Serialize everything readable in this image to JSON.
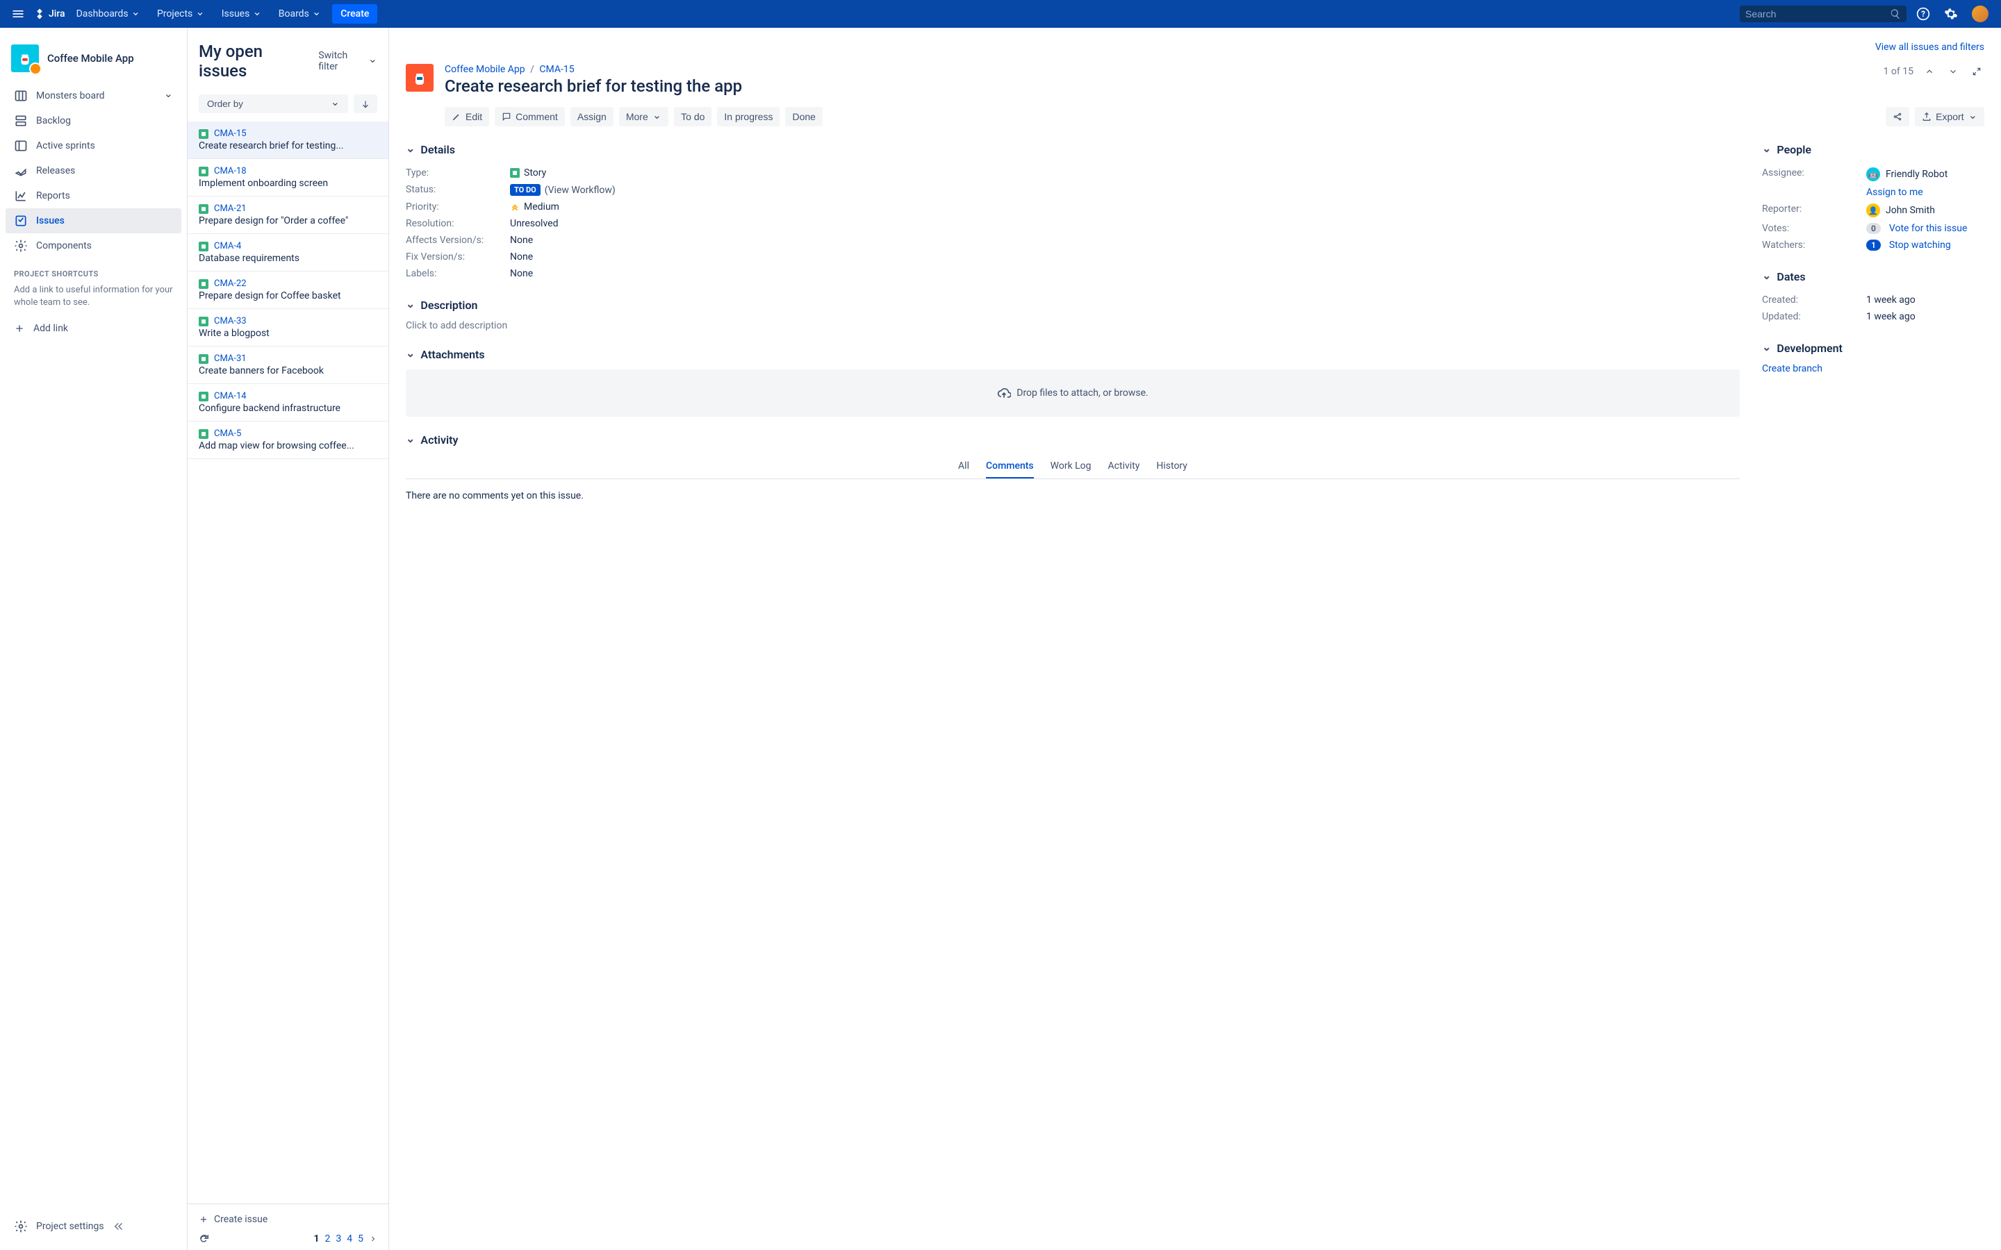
{
  "topnav": {
    "logo": "Jira",
    "items": [
      "Dashboards",
      "Projects",
      "Issues",
      "Boards"
    ],
    "create": "Create",
    "search_placeholder": "Search"
  },
  "sidebar": {
    "project_name": "Coffee Mobile App",
    "board_item": "Monsters board",
    "items": [
      {
        "label": "Backlog"
      },
      {
        "label": "Active sprints"
      },
      {
        "label": "Releases"
      },
      {
        "label": "Reports"
      },
      {
        "label": "Issues"
      },
      {
        "label": "Components"
      }
    ],
    "shortcuts_label": "PROJECT SHORTCUTS",
    "shortcuts_help": "Add a link to useful information for your whole team to see.",
    "add_link": "Add link",
    "project_settings": "Project settings"
  },
  "list": {
    "title": "My open issues",
    "switch_filter": "Switch filter",
    "view_all": "View all issues and filters",
    "order_by": "Order by",
    "issues": [
      {
        "key": "CMA-15",
        "title": "Create research brief for testing..."
      },
      {
        "key": "CMA-18",
        "title": "Implement onboarding screen"
      },
      {
        "key": "CMA-21",
        "title": "Prepare design for \"Order a coffee\""
      },
      {
        "key": "CMA-4",
        "title": "Database requirements"
      },
      {
        "key": "CMA-22",
        "title": "Prepare design for Coffee basket"
      },
      {
        "key": "CMA-33",
        "title": "Write a blogpost"
      },
      {
        "key": "CMA-31",
        "title": "Create banners for Facebook"
      },
      {
        "key": "CMA-14",
        "title": "Configure backend infrastructure"
      },
      {
        "key": "CMA-5",
        "title": "Add map view for browsing coffee..."
      }
    ],
    "create_issue": "Create issue",
    "pages": [
      "1",
      "2",
      "3",
      "4",
      "5"
    ]
  },
  "detail": {
    "project_link": "Coffee Mobile App",
    "issue_key": "CMA-15",
    "title": "Create research brief for testing the app",
    "pager": "1 of 15",
    "actions": {
      "edit": "Edit",
      "comment": "Comment",
      "assign": "Assign",
      "more": "More",
      "todo": "To do",
      "in_progress": "In progress",
      "done": "Done",
      "export": "Export"
    },
    "sections": {
      "details": "Details",
      "description": "Description",
      "attachments": "Attachments",
      "activity": "Activity",
      "people": "People",
      "dates": "Dates",
      "development": "Development"
    },
    "fields": {
      "type_label": "Type:",
      "type_value": "Story",
      "status_label": "Status:",
      "status_value": "TO DO",
      "status_workflow": "(View Workflow)",
      "priority_label": "Priority:",
      "priority_value": "Medium",
      "resolution_label": "Resolution:",
      "resolution_value": "Unresolved",
      "affects_label": "Affects Version/s:",
      "affects_value": "None",
      "fix_label": "Fix Version/s:",
      "fix_value": "None",
      "labels_label": "Labels:",
      "labels_value": "None"
    },
    "description_placeholder": "Click to add description",
    "dropzone": "Drop files to attach, or browse.",
    "activity_tabs": [
      "All",
      "Comments",
      "Work Log",
      "Activity",
      "History"
    ],
    "no_comments": "There are no comments yet on this issue.",
    "people": {
      "assignee_label": "Assignee:",
      "assignee_value": "Friendly Robot",
      "assign_to_me": "Assign to me",
      "reporter_label": "Reporter:",
      "reporter_value": "John Smith",
      "votes_label": "Votes:",
      "votes_count": "0",
      "vote_link": "Vote for this issue",
      "watchers_label": "Watchers:",
      "watchers_count": "1",
      "watch_link": "Stop watching"
    },
    "dates": {
      "created_label": "Created:",
      "created_value": "1 week ago",
      "updated_label": "Updated:",
      "updated_value": "1 week ago"
    },
    "development": {
      "create_branch": "Create branch"
    }
  }
}
